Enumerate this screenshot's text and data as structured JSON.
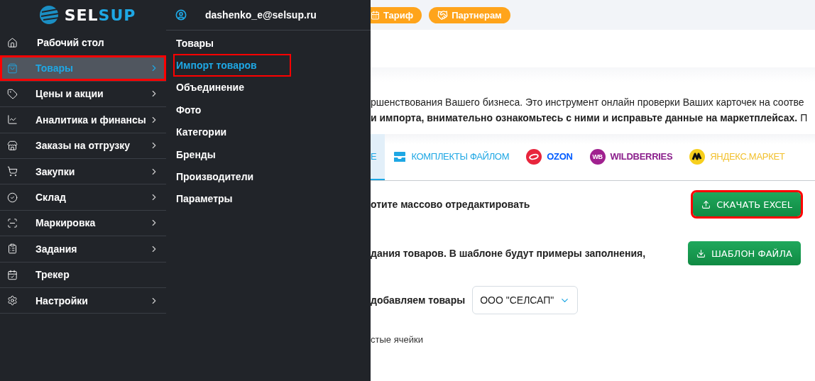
{
  "sidebar": {
    "logo": {
      "parts": [
        "SEL",
        "SUP"
      ]
    },
    "items": [
      {
        "label": "Рабочий стол",
        "selected": false,
        "annotated": false,
        "has_submenu": false
      },
      {
        "label": "Товары",
        "selected": true,
        "annotated": true,
        "has_submenu": true
      },
      {
        "label": "Цены и акции",
        "selected": false,
        "annotated": false,
        "has_submenu": true
      },
      {
        "label": "Аналитика и финансы",
        "selected": false,
        "annotated": false,
        "has_submenu": true
      },
      {
        "label": "Заказы на отгрузку",
        "selected": false,
        "annotated": false,
        "has_submenu": true
      },
      {
        "label": "Закупки",
        "selected": false,
        "annotated": false,
        "has_submenu": true
      },
      {
        "label": "Склад",
        "selected": false,
        "annotated": false,
        "has_submenu": true
      },
      {
        "label": "Маркировка",
        "selected": false,
        "annotated": false,
        "has_submenu": true
      },
      {
        "label": "Задания",
        "selected": false,
        "annotated": false,
        "has_submenu": true
      },
      {
        "label": "Трекер",
        "selected": false,
        "annotated": false,
        "has_submenu": false
      },
      {
        "label": "Настройки",
        "selected": false,
        "annotated": false,
        "has_submenu": true
      }
    ]
  },
  "submenu": {
    "user": "dashenko_e@selsup.ru",
    "items": [
      {
        "label": "Товары",
        "selected": false,
        "annotated": false
      },
      {
        "label": "Импорт товаров",
        "selected": true,
        "annotated": true
      },
      {
        "label": "Объединение",
        "selected": false,
        "annotated": false
      },
      {
        "label": "Фото",
        "selected": false,
        "annotated": false
      },
      {
        "label": "Категории",
        "selected": false,
        "annotated": false
      },
      {
        "label": "Бренды",
        "selected": false,
        "annotated": false
      },
      {
        "label": "Производители",
        "selected": false,
        "annotated": false
      },
      {
        "label": "Параметры",
        "selected": false,
        "annotated": false
      }
    ]
  },
  "topbar": {
    "pills": [
      {
        "label": "Тариф",
        "kind": "tariff"
      },
      {
        "label": "Партнерам",
        "kind": "partners"
      }
    ]
  },
  "intro": [
    "ршенствования Вашего бизнеса. Это инструмент онлайн проверки Ваших карточек на соотве",
    "**и импорта, внимательно ознакомьтесь с ними и исправьте данные на маркетплейсах.** П"
  ],
  "tabs": [
    {
      "label": "Е",
      "kind": "plain",
      "selected": true,
      "color": "#1ea7e4"
    },
    {
      "label": "КОМПЛЕКТЫ ФАЙЛОМ",
      "kind": "bundle",
      "selected": false,
      "color": "#1ea7e4"
    },
    {
      "label": "OZON",
      "kind": "ozon",
      "selected": false,
      "color": "#005bff"
    },
    {
      "label": "WILDBERRIES",
      "kind": "wb",
      "badge": "WB",
      "selected": false,
      "color": "#8b1f8c"
    },
    {
      "label": "ЯНДЕКС.МАРКЕТ",
      "kind": "yandex",
      "selected": false,
      "color": "#f2c12e"
    }
  ],
  "rows": [
    {
      "kind": "button",
      "text": "отите массово отредактировать",
      "button": {
        "label": "СКАЧАТЬ EXCEL",
        "kind": "upload",
        "annotated": true
      }
    },
    {
      "kind": "button",
      "text": "дания товаров. В шаблоне будут примеры заполнения,",
      "button": {
        "label": "ШАБЛОН ФАЙЛА",
        "kind": "download",
        "annotated": false
      }
    },
    {
      "kind": "select",
      "text": "добавляем товары",
      "select": {
        "value": "ООО \"СЕЛСАП\""
      }
    },
    {
      "kind": "note",
      "text": "стые ячейки"
    }
  ]
}
